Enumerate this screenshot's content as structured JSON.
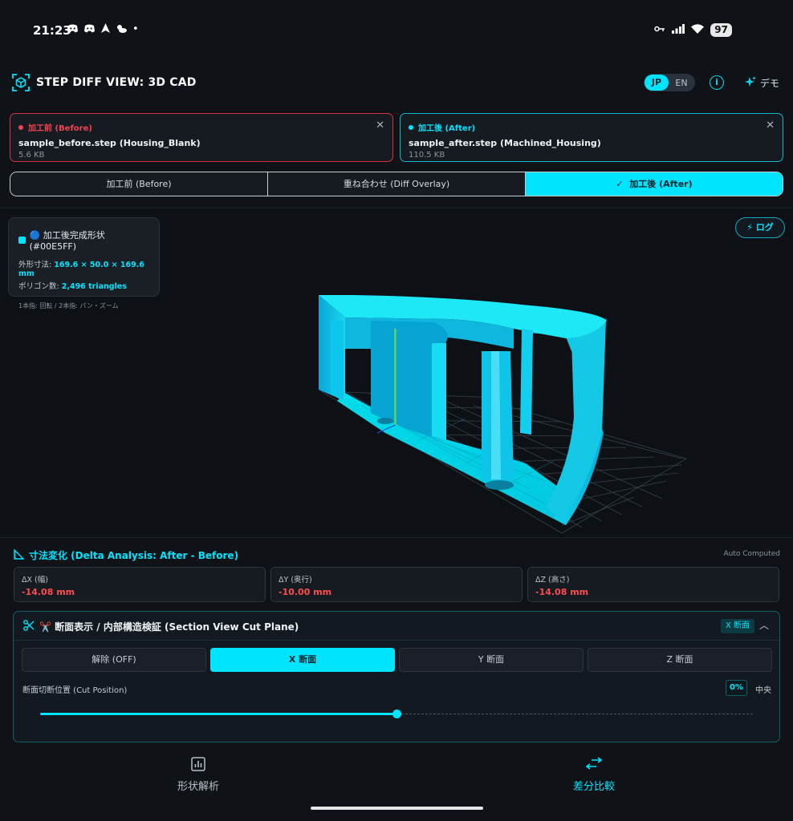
{
  "status_bar": {
    "time": "21:23",
    "left_icons": [
      "discord-icon",
      "discord-icon",
      "navigation-icon",
      "weather-icon",
      "dot"
    ],
    "battery": "97"
  },
  "header": {
    "title": "STEP DIFF VIEW: 3D CAD",
    "lang": {
      "jp": "JP",
      "en": "EN",
      "selected": "JP"
    },
    "info_icon": "info-icon",
    "demo_label": "デモ"
  },
  "files": {
    "before": {
      "label": "加工前 (Before)",
      "name": "sample_before.step (Housing_Blank)",
      "size": "5.6 KB",
      "color": "#f0434f"
    },
    "after": {
      "label": "加工後 (After)",
      "name": "sample_after.step (Machined_Housing)",
      "size": "110.5 KB",
      "color": "#00e5ff"
    }
  },
  "view_tabs": [
    {
      "label": "加工前 (Before)",
      "active": false
    },
    {
      "label": "重ね合わせ (Diff Overlay)",
      "active": false
    },
    {
      "label": "加工後 (After)",
      "active": true
    }
  ],
  "viewport": {
    "info": {
      "title": "🔵 加工後完成形状 (#00E5FF)",
      "dims_label": "外形寸法:",
      "dims_value": "169.6 × 50.0 × 169.6 mm",
      "poly_label": "ポリゴン数:",
      "poly_value": "2,496 triangles",
      "hint": "1本指: 回転 / 2本指: パン・ズーム"
    },
    "log_button": "⚡ ログ",
    "model_color": "#00E5FF"
  },
  "delta": {
    "title": "寸法変化 (Delta Analysis: After - Before)",
    "auto": "Auto Computed",
    "cards": [
      {
        "label": "ΔX (幅)",
        "value": "-14.08 mm"
      },
      {
        "label": "ΔY (奥行)",
        "value": "-10.00 mm"
      },
      {
        "label": "ΔZ (高さ)",
        "value": "-14.08 mm"
      }
    ]
  },
  "section": {
    "title": "✂️ 断面表示 / 内部構造検証 (Section View Cut Plane)",
    "badge": "X 断面",
    "buttons": [
      {
        "label": "解除 (OFF)",
        "active": false
      },
      {
        "label": "X 断面",
        "active": true
      },
      {
        "label": "Y 断面",
        "active": false
      },
      {
        "label": "Z 断面",
        "active": false
      }
    ],
    "cut_label": "断面切断位置 (Cut Position)",
    "cut_percent": "0%",
    "cut_center": "中央",
    "slider_value": 0.5
  },
  "bottom_nav": [
    {
      "label": "形状解析",
      "icon": "bar-chart-icon",
      "active": false
    },
    {
      "label": "差分比較",
      "icon": "compare-arrows-icon",
      "active": true
    }
  ]
}
